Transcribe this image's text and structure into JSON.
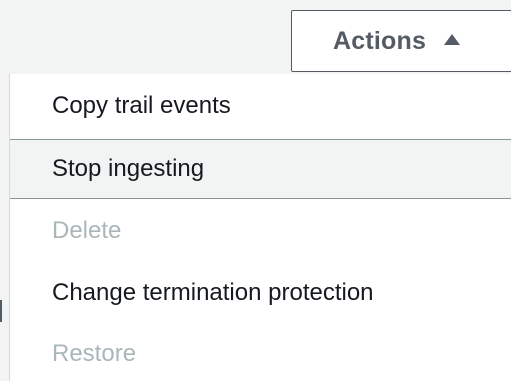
{
  "actions_button": {
    "label": "Actions",
    "icon": "caret-up-icon"
  },
  "menu": {
    "items": [
      {
        "label": "Copy trail events",
        "state": "enabled"
      },
      {
        "label": "Stop ingesting",
        "state": "hovered"
      },
      {
        "label": "Delete",
        "state": "disabled"
      },
      {
        "label": "Change termination protection",
        "state": "enabled"
      },
      {
        "label": "Restore",
        "state": "disabled"
      }
    ]
  },
  "colors": {
    "background": "#f2f3f3",
    "button_text": "#545b64",
    "menu_text": "#16191f",
    "disabled_text": "#aab7b8",
    "hover_border": "#879596"
  }
}
